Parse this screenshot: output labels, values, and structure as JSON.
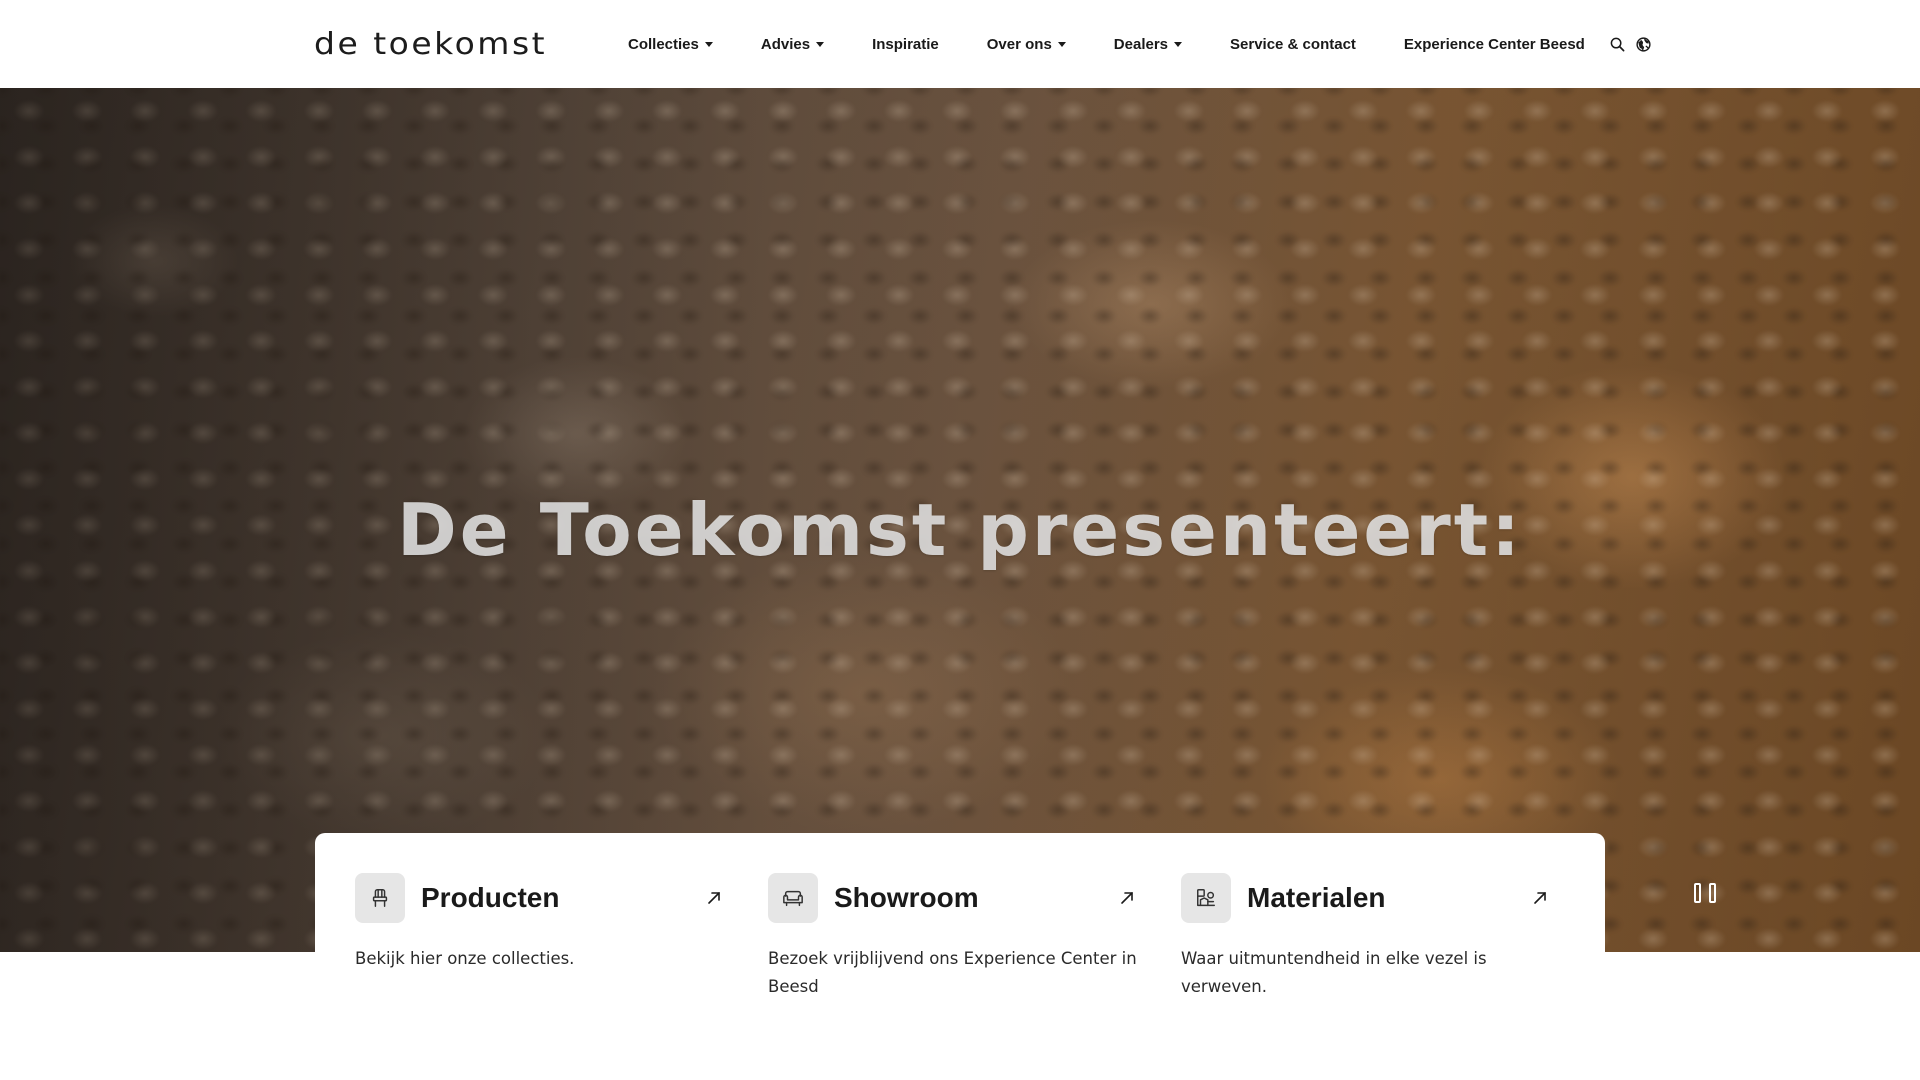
{
  "header": {
    "logo": "de toekomst",
    "nav": [
      {
        "label": "Collecties",
        "dropdown": true
      },
      {
        "label": "Advies",
        "dropdown": true
      },
      {
        "label": "Inspiratie",
        "dropdown": false
      },
      {
        "label": "Over ons",
        "dropdown": true
      },
      {
        "label": "Dealers",
        "dropdown": true
      },
      {
        "label": "Service & contact",
        "dropdown": false
      },
      {
        "label": "Experience Center Beesd",
        "dropdown": false
      }
    ],
    "icons": [
      "search-icon",
      "globe-icon"
    ]
  },
  "hero": {
    "title": "De Toekomst presenteert:",
    "video_control": "pause-icon"
  },
  "cards": [
    {
      "title": "Producten",
      "description": "Bekijk hier onze collecties.",
      "icon": "chair-icon",
      "link_icon": "arrow-up-right-icon"
    },
    {
      "title": "Showroom",
      "description": "Bezoek vrijblijvend ons Experience Center in Beesd",
      "icon": "sofa-icon",
      "link_icon": "arrow-up-right-icon"
    },
    {
      "title": "Materialen",
      "description": "Waar uitmuntendheid in elke vezel is verweven.",
      "icon": "materials-icon",
      "link_icon": "arrow-up-right-icon"
    }
  ],
  "colors": {
    "text": "#1a1a1a",
    "icon_box": "#e6e6e6",
    "hero_title": "#e1e1e1"
  }
}
